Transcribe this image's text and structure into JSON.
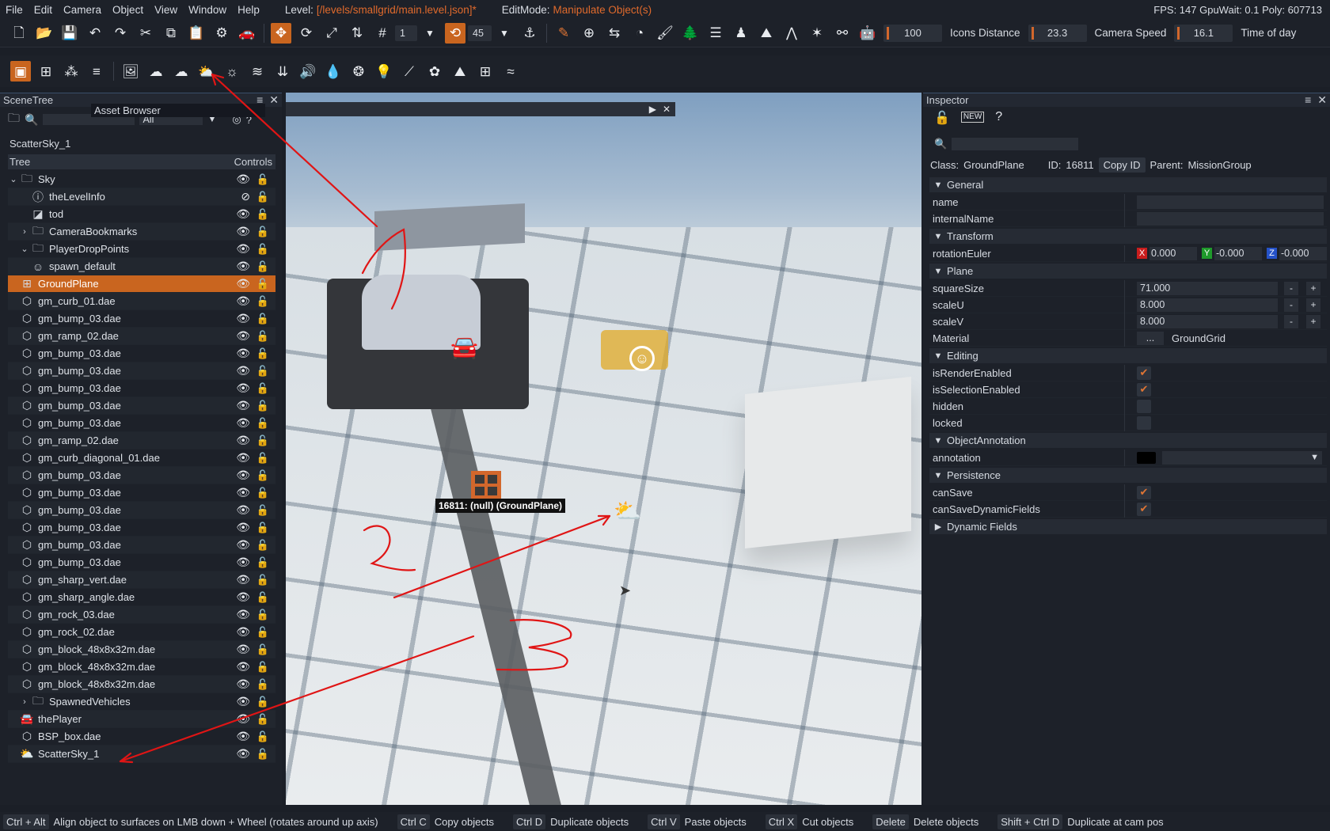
{
  "menubar": {
    "items": [
      "File",
      "Edit",
      "Camera",
      "Object",
      "View",
      "Window",
      "Help"
    ],
    "level_label": "Level:",
    "level_value": "[/levels/smallgrid/main.level.json]*",
    "editmode_label": "EditMode:",
    "editmode_value": "Manipulate Object(s)",
    "stats": "FPS: 147  GpuWait: 0.1  Poly: 607713"
  },
  "toolbar1": {
    "grid_value": "1",
    "rotate_snap": "45",
    "slider1_value": "100",
    "icons_distance_label": "Icons Distance",
    "camera_speed_value": "23.3",
    "camera_speed_label": "Camera Speed",
    "time_value": "16.1",
    "time_label": "Time of day"
  },
  "asset_browser_tooltip": "Asset Browser",
  "scenetree": {
    "title": "SceneTree",
    "filter_value": "All",
    "selected_name": "ScatterSky_1",
    "header_tree": "Tree",
    "header_controls": "Controls",
    "rows": [
      {
        "label": "Sky",
        "exp": "⌄",
        "icon": "folder",
        "indent": 0
      },
      {
        "label": "theLevelInfo",
        "exp": "",
        "icon": "info",
        "indent": 1,
        "hidden": true
      },
      {
        "label": "tod",
        "exp": "",
        "icon": "tod",
        "indent": 1
      },
      {
        "label": "CameraBookmarks",
        "exp": "›",
        "icon": "folder",
        "indent": 1
      },
      {
        "label": "PlayerDropPoints",
        "exp": "⌄",
        "icon": "folder",
        "indent": 1
      },
      {
        "label": "spawn_default",
        "exp": "",
        "icon": "spawn",
        "indent": 1
      },
      {
        "label": "GroundPlane",
        "exp": "",
        "icon": "grid",
        "indent": 0,
        "selected": true
      },
      {
        "label": "gm_curb_01.dae",
        "exp": "",
        "icon": "mesh",
        "indent": 0
      },
      {
        "label": "gm_bump_03.dae",
        "exp": "",
        "icon": "mesh",
        "indent": 0
      },
      {
        "label": "gm_ramp_02.dae",
        "exp": "",
        "icon": "mesh",
        "indent": 0
      },
      {
        "label": "gm_bump_03.dae",
        "exp": "",
        "icon": "mesh",
        "indent": 0
      },
      {
        "label": "gm_bump_03.dae",
        "exp": "",
        "icon": "mesh",
        "indent": 0
      },
      {
        "label": "gm_bump_03.dae",
        "exp": "",
        "icon": "mesh",
        "indent": 0
      },
      {
        "label": "gm_bump_03.dae",
        "exp": "",
        "icon": "mesh",
        "indent": 0
      },
      {
        "label": "gm_bump_03.dae",
        "exp": "",
        "icon": "mesh",
        "indent": 0
      },
      {
        "label": "gm_ramp_02.dae",
        "exp": "",
        "icon": "mesh",
        "indent": 0
      },
      {
        "label": "gm_curb_diagonal_01.dae",
        "exp": "",
        "icon": "mesh",
        "indent": 0
      },
      {
        "label": "gm_bump_03.dae",
        "exp": "",
        "icon": "mesh",
        "indent": 0
      },
      {
        "label": "gm_bump_03.dae",
        "exp": "",
        "icon": "mesh",
        "indent": 0
      },
      {
        "label": "gm_bump_03.dae",
        "exp": "",
        "icon": "mesh",
        "indent": 0
      },
      {
        "label": "gm_bump_03.dae",
        "exp": "",
        "icon": "mesh",
        "indent": 0
      },
      {
        "label": "gm_bump_03.dae",
        "exp": "",
        "icon": "mesh",
        "indent": 0
      },
      {
        "label": "gm_bump_03.dae",
        "exp": "",
        "icon": "mesh",
        "indent": 0
      },
      {
        "label": "gm_sharp_vert.dae",
        "exp": "",
        "icon": "mesh",
        "indent": 0
      },
      {
        "label": "gm_sharp_angle.dae",
        "exp": "",
        "icon": "mesh",
        "indent": 0
      },
      {
        "label": "gm_rock_03.dae",
        "exp": "",
        "icon": "mesh",
        "indent": 0
      },
      {
        "label": "gm_rock_02.dae",
        "exp": "",
        "icon": "mesh",
        "indent": 0
      },
      {
        "label": "gm_block_48x8x32m.dae",
        "exp": "",
        "icon": "mesh",
        "indent": 0
      },
      {
        "label": "gm_block_48x8x32m.dae",
        "exp": "",
        "icon": "mesh",
        "indent": 0
      },
      {
        "label": "gm_block_48x8x32m.dae",
        "exp": "",
        "icon": "mesh",
        "indent": 0
      },
      {
        "label": "SpawnedVehicles",
        "exp": "›",
        "icon": "folder",
        "indent": 1
      },
      {
        "label": "thePlayer",
        "exp": "",
        "icon": "car",
        "indent": 0
      },
      {
        "label": "BSP_box.dae",
        "exp": "",
        "icon": "mesh",
        "indent": 0
      },
      {
        "label": "ScatterSky_1",
        "exp": "",
        "icon": "sky",
        "indent": 0
      }
    ]
  },
  "viewport": {
    "object_label": "16811: (null) (GroundPlane)",
    "annotation_numbers": [
      "2",
      "3"
    ]
  },
  "inspector": {
    "title": "Inspector",
    "class_label": "Class:",
    "class_value": "GroundPlane",
    "id_label": "ID:",
    "id_value": "16811",
    "copy_id": "Copy ID",
    "parent_label": "Parent:",
    "parent_value": "MissionGroup",
    "sections": {
      "general": "General",
      "transform": "Transform",
      "plane": "Plane",
      "editing": "Editing",
      "annotation": "ObjectAnnotation",
      "persistence": "Persistence",
      "dynamic": "Dynamic Fields"
    },
    "props": {
      "name": "name",
      "internalName": "internalName",
      "rotationEuler": "rotationEuler",
      "rot_x": "0.000",
      "rot_y": "-0.000",
      "rot_z": "-0.000",
      "squareSize": "squareSize",
      "squareSize_value": "71.000",
      "scaleU": "scaleU",
      "scaleU_value": "8.000",
      "scaleV": "scaleV",
      "scaleV_value": "8.000",
      "material": "Material",
      "material_btn": "...",
      "material_value": "GroundGrid",
      "isRenderEnabled": "isRenderEnabled",
      "isSelectionEnabled": "isSelectionEnabled",
      "hidden": "hidden",
      "locked": "locked",
      "annotation": "annotation",
      "canSave": "canSave",
      "canSaveDynamicFields": "canSaveDynamicFields"
    }
  },
  "statusbar": {
    "items": [
      {
        "key": "Ctrl + Alt",
        "desc": "Align object to surfaces on LMB down + Wheel (rotates around up axis)"
      },
      {
        "key": "Ctrl C",
        "desc": "Copy objects"
      },
      {
        "key": "Ctrl D",
        "desc": "Duplicate objects"
      },
      {
        "key": "Ctrl V",
        "desc": "Paste objects"
      },
      {
        "key": "Ctrl X",
        "desc": "Cut objects"
      },
      {
        "key": "Delete",
        "desc": "Delete objects"
      },
      {
        "key": "Shift + Ctrl D",
        "desc": "Duplicate at cam pos"
      }
    ]
  },
  "colors": {
    "accent": "#c9651f",
    "annotation_red": "#e01515"
  }
}
